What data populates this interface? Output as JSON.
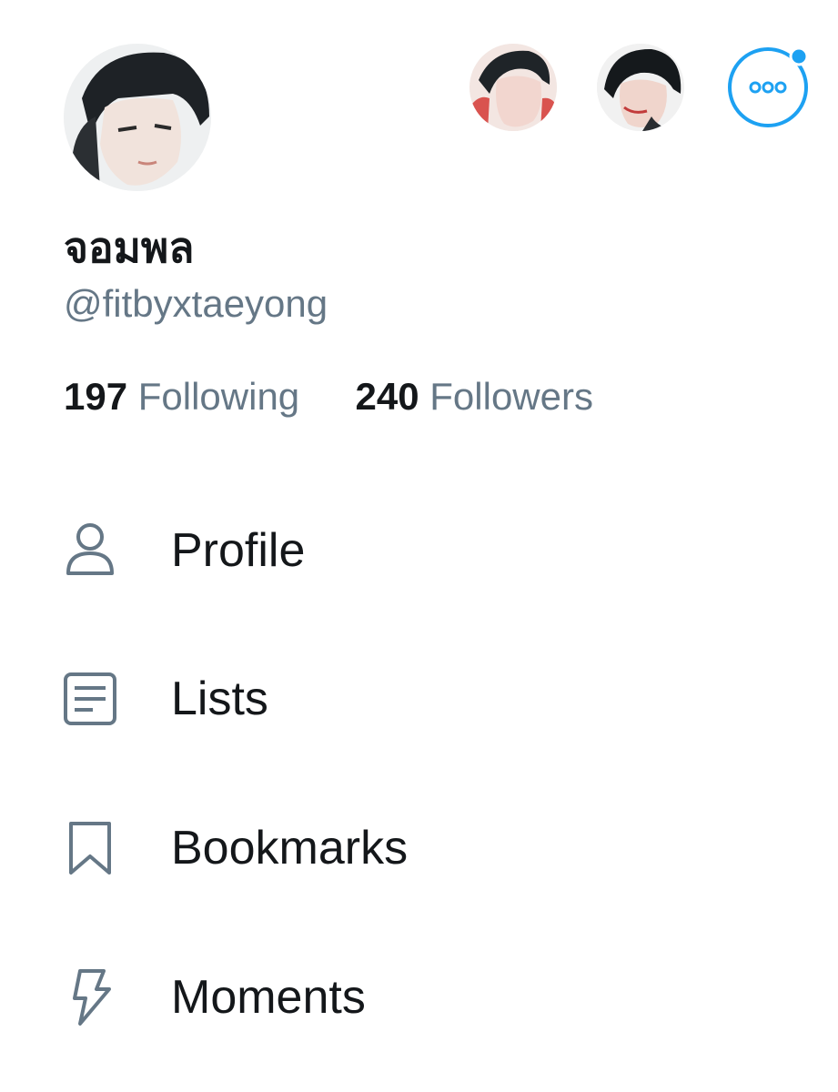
{
  "profile": {
    "display_name": "จอมพล",
    "handle": "@fitbyxtaeyong"
  },
  "stats": {
    "following_count": "197",
    "following_label": "Following",
    "followers_count": "240",
    "followers_label": "Followers"
  },
  "header": {
    "more_button_icon": "more-horizontal-icon",
    "accent_color": "#1da1f2"
  },
  "menu": {
    "items": [
      {
        "label": "Profile",
        "icon": "person-icon"
      },
      {
        "label": "Lists",
        "icon": "list-document-icon"
      },
      {
        "label": "Bookmarks",
        "icon": "bookmark-icon"
      },
      {
        "label": "Moments",
        "icon": "lightning-bolt-icon"
      }
    ]
  }
}
